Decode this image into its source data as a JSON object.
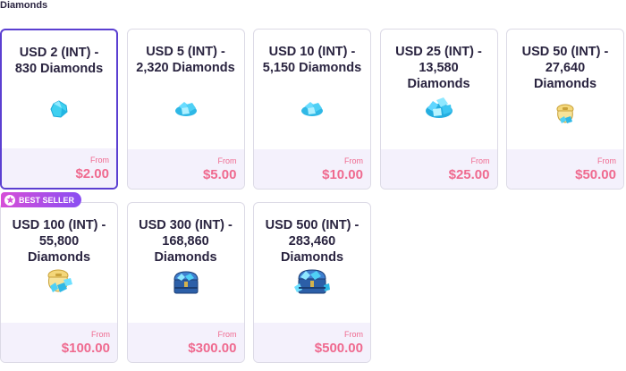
{
  "section": {
    "title": "Diamonds"
  },
  "badge": {
    "label": "BEST SELLER"
  },
  "products": [
    {
      "title": "USD 2 (INT) - 830 Diamonds",
      "from": "From",
      "price": "$2.00",
      "icon": "diamond-small-icon"
    },
    {
      "title": "USD 5 (INT) - 2,320 Diamonds",
      "from": "From",
      "price": "$5.00",
      "icon": "diamond-pile-icon"
    },
    {
      "title": "USD 10 (INT) - 5,150 Diamonds",
      "from": "From",
      "price": "$10.00",
      "icon": "diamond-pile-icon"
    },
    {
      "title": "USD 25 (INT) - 13,580 Diamonds",
      "from": "From",
      "price": "$25.00",
      "icon": "diamond-large-pile-icon"
    },
    {
      "title": "USD 50 (INT) - 27,640 Diamonds",
      "from": "From",
      "price": "$50.00",
      "icon": "diamond-bag-icon"
    },
    {
      "title": "USD 100 (INT) - 55,800 Diamonds",
      "from": "From",
      "price": "$100.00",
      "icon": "diamond-bag-large-icon"
    },
    {
      "title": "USD 300 (INT) - 168,860 Diamonds",
      "from": "From",
      "price": "$300.00",
      "icon": "diamond-chest-icon"
    },
    {
      "title": "USD 500 (INT) - 283,460 Diamonds",
      "from": "From",
      "price": "$500.00",
      "icon": "diamond-chest-large-icon"
    }
  ]
}
